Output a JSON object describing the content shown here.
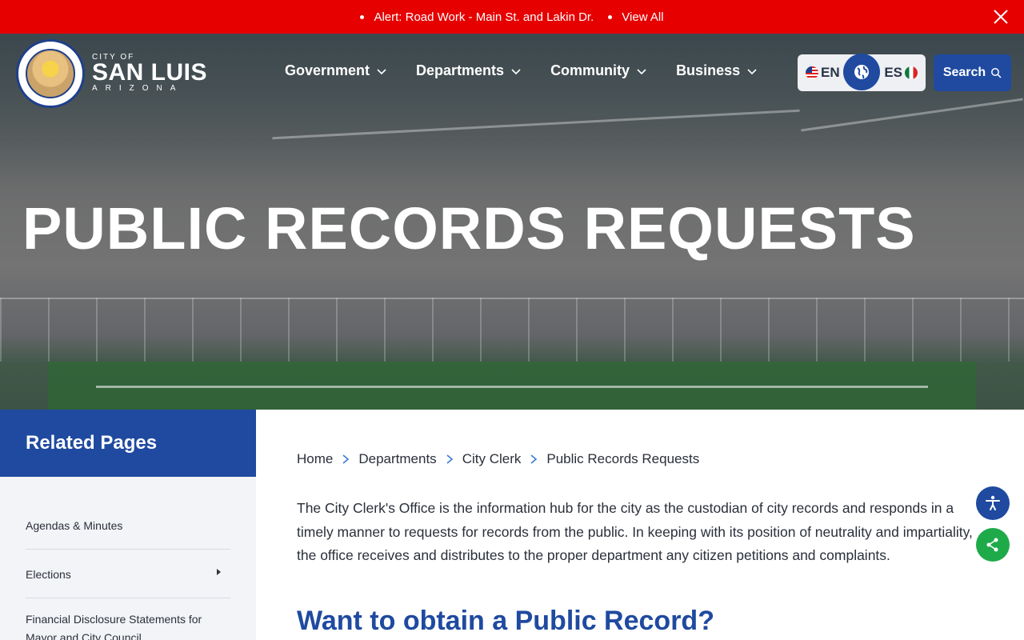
{
  "alert": {
    "message": "Alert: Road Work - Main St. and Lakin Dr.",
    "view_all": "View All"
  },
  "brand": {
    "small": "CITY OF",
    "name": "SAN LUIS",
    "state": "ARIZONA"
  },
  "nav": {
    "items": [
      {
        "label": "Government"
      },
      {
        "label": "Departments"
      },
      {
        "label": "Community"
      },
      {
        "label": "Business"
      }
    ]
  },
  "lang": {
    "en": "EN",
    "es": "ES"
  },
  "search": {
    "label": "Search"
  },
  "hero": {
    "title": "PUBLIC RECORDS REQUESTS"
  },
  "sidebar": {
    "title": "Related Pages",
    "items": [
      {
        "label": "Agendas & Minutes"
      },
      {
        "label": "Elections"
      },
      {
        "label": "Financial Disclosure Statements for Mayor and City Council"
      }
    ]
  },
  "breadcrumb": {
    "items": [
      "Home",
      "Departments",
      "City Clerk",
      "Public Records Requests"
    ]
  },
  "content": {
    "intro": "The City Clerk's Office is the information hub for the city as the custodian of city records and responds in a timely manner to requests for records from the public. In keeping with its position of neutrality and impartiality, the office receives and distributes to the proper department any citizen petitions and complaints.",
    "subhead": "Want to obtain a Public Record?"
  },
  "colors": {
    "alert_red": "#e60000",
    "brand_blue": "#1f4aa0",
    "share_green": "#1faa4a"
  },
  "icons": {
    "close": "close-icon",
    "chevron": "chevron-down-icon",
    "globe": "globe-icon",
    "search": "search-icon",
    "breadcrumb_sep": "chevron-right-icon",
    "accessibility": "accessibility-icon",
    "share": "share-icon"
  }
}
